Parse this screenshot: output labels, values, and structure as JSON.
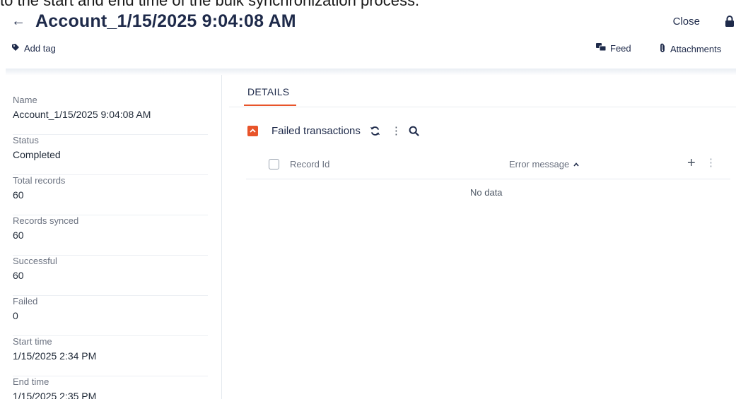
{
  "intro_text": "to the start and end time of the bulk synchronization process.",
  "header": {
    "back_icon": "arrow-left-icon",
    "title": "Account_1/15/2025 9:04:08 AM",
    "close_label": "Close",
    "lock_icon": "lock-icon"
  },
  "subbar": {
    "add_tag_label": "Add tag",
    "feed_label": "Feed",
    "attachments_label": "Attachments"
  },
  "fields": [
    {
      "label": "Name",
      "value": "Account_1/15/2025 9:04:08 AM"
    },
    {
      "label": "Status",
      "value": "Completed"
    },
    {
      "label": "Total records",
      "value": "60"
    },
    {
      "label": "Records synced",
      "value": "60"
    },
    {
      "label": "Successful",
      "value": "60"
    },
    {
      "label": "Failed",
      "value": "0"
    },
    {
      "label": "Start time",
      "value": "1/15/2025 2:34 PM"
    },
    {
      "label": "End time",
      "value": "1/15/2025 2:35 PM"
    }
  ],
  "details": {
    "tab_label": "DETAILS",
    "section_title": "Failed transactions",
    "columns": [
      "Record Id",
      "Error message"
    ],
    "sort_direction": "ascending",
    "empty_text": "No data"
  },
  "colors": {
    "accent": "#e8542a",
    "text_dark": "#1e2a4a",
    "text_muted": "#6b7280"
  }
}
